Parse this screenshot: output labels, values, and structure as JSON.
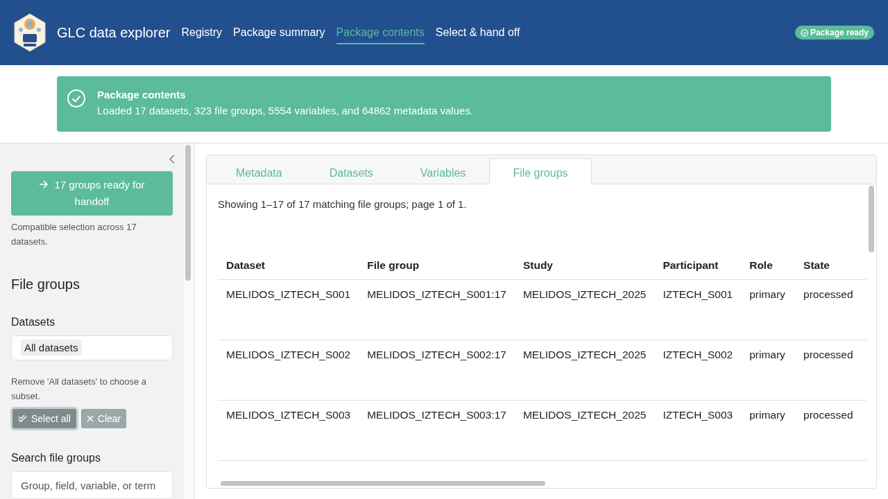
{
  "header": {
    "app_title": "GLC data explorer",
    "nav": [
      {
        "label": "Registry",
        "selected": false
      },
      {
        "label": "Package summary",
        "selected": false
      },
      {
        "label": "Package contents",
        "selected": true
      },
      {
        "label": "Select & hand off",
        "selected": false
      }
    ],
    "status_badge": "Package ready"
  },
  "alert": {
    "title": "Package contents",
    "message": "Loaded 17 datasets, 323 file groups, 5554 variables, and 64862 metadata values."
  },
  "sidebar": {
    "handoff_button": "17 groups ready for handoff",
    "handoff_note": "Compatible selection across 17 datasets.",
    "section_title": "File groups",
    "datasets": {
      "label": "Datasets",
      "chips": [
        "All datasets"
      ],
      "hint": "Remove 'All datasets' to choose a subset."
    },
    "buttons": [
      {
        "label": "Select all",
        "kind": "select"
      },
      {
        "label": "Clear",
        "kind": "clear"
      }
    ],
    "search": {
      "label": "Search file groups",
      "placeholder": "Group, field, variable, or term"
    }
  },
  "main": {
    "tabs": [
      {
        "label": "Metadata",
        "selected": false
      },
      {
        "label": "Datasets",
        "selected": false
      },
      {
        "label": "Variables",
        "selected": false
      },
      {
        "label": "File groups",
        "selected": true
      }
    ],
    "summary": "Showing 1–17 of 17 matching file groups; page 1 of 1.",
    "table": {
      "columns": [
        "Dataset",
        "File group",
        "Study",
        "Participant",
        "Role",
        "State"
      ],
      "rows": [
        [
          "MELIDOS_IZTECH_S001",
          "MELIDOS_IZTECH_S001:17",
          "MELIDOS_IZTECH_2025",
          "IZTECH_S001",
          "primary",
          "processed"
        ],
        [
          "MELIDOS_IZTECH_S002",
          "MELIDOS_IZTECH_S002:17",
          "MELIDOS_IZTECH_2025",
          "IZTECH_S002",
          "primary",
          "processed"
        ],
        [
          "MELIDOS_IZTECH_S003",
          "MELIDOS_IZTECH_S003:17",
          "MELIDOS_IZTECH_2025",
          "IZTECH_S003",
          "primary",
          "processed"
        ]
      ]
    }
  }
}
